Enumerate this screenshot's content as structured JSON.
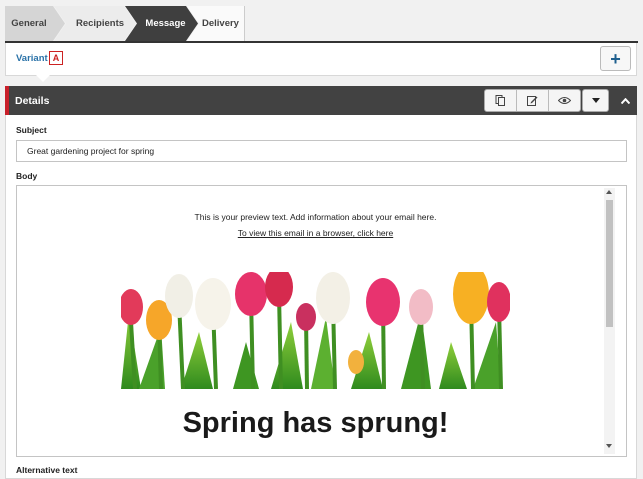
{
  "steps": [
    {
      "label": "General"
    },
    {
      "label": "Recipients"
    },
    {
      "label": "Message"
    },
    {
      "label": "Delivery"
    }
  ],
  "active_step": "Message",
  "variant": {
    "label": "Variant",
    "badge": "A"
  },
  "add_button": {
    "label": "+"
  },
  "details": {
    "title": "Details"
  },
  "toolbar_icons": [
    "copy-icon",
    "edit-icon",
    "preview-eye-icon"
  ],
  "subject": {
    "label": "Subject",
    "value": "Great gardening project for spring"
  },
  "body": {
    "label": "Body",
    "preview_text": "This is your preview text. Add information about your email here.",
    "browser_link": "To view this email in a browser, click here",
    "headline": "Spring has sprung!"
  },
  "alt_text": {
    "label": "Alternative text"
  },
  "colors": {
    "accent": "#c8202a",
    "header_bg": "#424242",
    "link": "#2a72a8",
    "active_step": "#3f3f3f"
  }
}
